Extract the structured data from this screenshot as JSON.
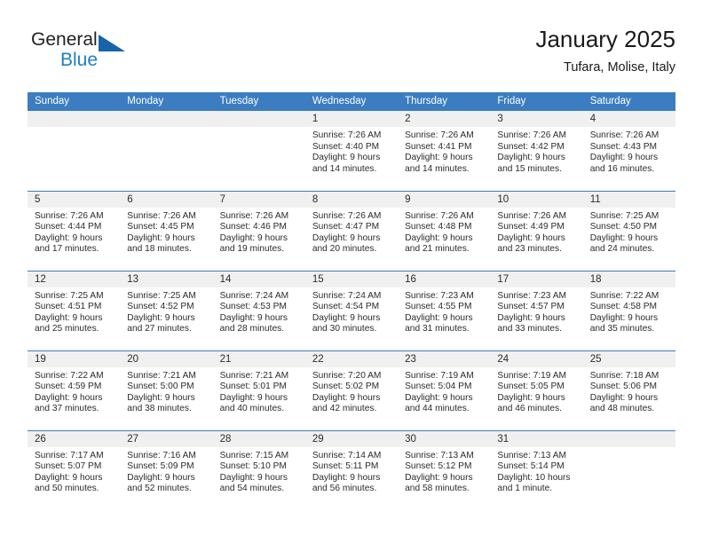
{
  "brand": {
    "name_part1": "General",
    "name_part2": "Blue",
    "triangle_color": "#1765a8",
    "blue_color": "#1c7fc4"
  },
  "header": {
    "title": "January 2025",
    "subtitle": "Tufara, Molise, Italy"
  },
  "theme": {
    "header_bg": "#3b7dc0",
    "daynum_band_bg": "#f0f0f0",
    "row_divider": "#3b7dc0",
    "text": "#2b2b2b"
  },
  "weekday_headers": [
    "Sunday",
    "Monday",
    "Tuesday",
    "Wednesday",
    "Thursday",
    "Friday",
    "Saturday"
  ],
  "weeks": [
    [
      {
        "day": "",
        "lines": []
      },
      {
        "day": "",
        "lines": []
      },
      {
        "day": "",
        "lines": []
      },
      {
        "day": "1",
        "lines": [
          "Sunrise: 7:26 AM",
          "Sunset: 4:40 PM",
          "Daylight: 9 hours",
          "and 14 minutes."
        ]
      },
      {
        "day": "2",
        "lines": [
          "Sunrise: 7:26 AM",
          "Sunset: 4:41 PM",
          "Daylight: 9 hours",
          "and 14 minutes."
        ]
      },
      {
        "day": "3",
        "lines": [
          "Sunrise: 7:26 AM",
          "Sunset: 4:42 PM",
          "Daylight: 9 hours",
          "and 15 minutes."
        ]
      },
      {
        "day": "4",
        "lines": [
          "Sunrise: 7:26 AM",
          "Sunset: 4:43 PM",
          "Daylight: 9 hours",
          "and 16 minutes."
        ]
      }
    ],
    [
      {
        "day": "5",
        "lines": [
          "Sunrise: 7:26 AM",
          "Sunset: 4:44 PM",
          "Daylight: 9 hours",
          "and 17 minutes."
        ]
      },
      {
        "day": "6",
        "lines": [
          "Sunrise: 7:26 AM",
          "Sunset: 4:45 PM",
          "Daylight: 9 hours",
          "and 18 minutes."
        ]
      },
      {
        "day": "7",
        "lines": [
          "Sunrise: 7:26 AM",
          "Sunset: 4:46 PM",
          "Daylight: 9 hours",
          "and 19 minutes."
        ]
      },
      {
        "day": "8",
        "lines": [
          "Sunrise: 7:26 AM",
          "Sunset: 4:47 PM",
          "Daylight: 9 hours",
          "and 20 minutes."
        ]
      },
      {
        "day": "9",
        "lines": [
          "Sunrise: 7:26 AM",
          "Sunset: 4:48 PM",
          "Daylight: 9 hours",
          "and 21 minutes."
        ]
      },
      {
        "day": "10",
        "lines": [
          "Sunrise: 7:26 AM",
          "Sunset: 4:49 PM",
          "Daylight: 9 hours",
          "and 23 minutes."
        ]
      },
      {
        "day": "11",
        "lines": [
          "Sunrise: 7:25 AM",
          "Sunset: 4:50 PM",
          "Daylight: 9 hours",
          "and 24 minutes."
        ]
      }
    ],
    [
      {
        "day": "12",
        "lines": [
          "Sunrise: 7:25 AM",
          "Sunset: 4:51 PM",
          "Daylight: 9 hours",
          "and 25 minutes."
        ]
      },
      {
        "day": "13",
        "lines": [
          "Sunrise: 7:25 AM",
          "Sunset: 4:52 PM",
          "Daylight: 9 hours",
          "and 27 minutes."
        ]
      },
      {
        "day": "14",
        "lines": [
          "Sunrise: 7:24 AM",
          "Sunset: 4:53 PM",
          "Daylight: 9 hours",
          "and 28 minutes."
        ]
      },
      {
        "day": "15",
        "lines": [
          "Sunrise: 7:24 AM",
          "Sunset: 4:54 PM",
          "Daylight: 9 hours",
          "and 30 minutes."
        ]
      },
      {
        "day": "16",
        "lines": [
          "Sunrise: 7:23 AM",
          "Sunset: 4:55 PM",
          "Daylight: 9 hours",
          "and 31 minutes."
        ]
      },
      {
        "day": "17",
        "lines": [
          "Sunrise: 7:23 AM",
          "Sunset: 4:57 PM",
          "Daylight: 9 hours",
          "and 33 minutes."
        ]
      },
      {
        "day": "18",
        "lines": [
          "Sunrise: 7:22 AM",
          "Sunset: 4:58 PM",
          "Daylight: 9 hours",
          "and 35 minutes."
        ]
      }
    ],
    [
      {
        "day": "19",
        "lines": [
          "Sunrise: 7:22 AM",
          "Sunset: 4:59 PM",
          "Daylight: 9 hours",
          "and 37 minutes."
        ]
      },
      {
        "day": "20",
        "lines": [
          "Sunrise: 7:21 AM",
          "Sunset: 5:00 PM",
          "Daylight: 9 hours",
          "and 38 minutes."
        ]
      },
      {
        "day": "21",
        "lines": [
          "Sunrise: 7:21 AM",
          "Sunset: 5:01 PM",
          "Daylight: 9 hours",
          "and 40 minutes."
        ]
      },
      {
        "day": "22",
        "lines": [
          "Sunrise: 7:20 AM",
          "Sunset: 5:02 PM",
          "Daylight: 9 hours",
          "and 42 minutes."
        ]
      },
      {
        "day": "23",
        "lines": [
          "Sunrise: 7:19 AM",
          "Sunset: 5:04 PM",
          "Daylight: 9 hours",
          "and 44 minutes."
        ]
      },
      {
        "day": "24",
        "lines": [
          "Sunrise: 7:19 AM",
          "Sunset: 5:05 PM",
          "Daylight: 9 hours",
          "and 46 minutes."
        ]
      },
      {
        "day": "25",
        "lines": [
          "Sunrise: 7:18 AM",
          "Sunset: 5:06 PM",
          "Daylight: 9 hours",
          "and 48 minutes."
        ]
      }
    ],
    [
      {
        "day": "26",
        "lines": [
          "Sunrise: 7:17 AM",
          "Sunset: 5:07 PM",
          "Daylight: 9 hours",
          "and 50 minutes."
        ]
      },
      {
        "day": "27",
        "lines": [
          "Sunrise: 7:16 AM",
          "Sunset: 5:09 PM",
          "Daylight: 9 hours",
          "and 52 minutes."
        ]
      },
      {
        "day": "28",
        "lines": [
          "Sunrise: 7:15 AM",
          "Sunset: 5:10 PM",
          "Daylight: 9 hours",
          "and 54 minutes."
        ]
      },
      {
        "day": "29",
        "lines": [
          "Sunrise: 7:14 AM",
          "Sunset: 5:11 PM",
          "Daylight: 9 hours",
          "and 56 minutes."
        ]
      },
      {
        "day": "30",
        "lines": [
          "Sunrise: 7:13 AM",
          "Sunset: 5:12 PM",
          "Daylight: 9 hours",
          "and 58 minutes."
        ]
      },
      {
        "day": "31",
        "lines": [
          "Sunrise: 7:13 AM",
          "Sunset: 5:14 PM",
          "Daylight: 10 hours",
          "and 1 minute."
        ]
      },
      {
        "day": "",
        "lines": []
      }
    ]
  ]
}
